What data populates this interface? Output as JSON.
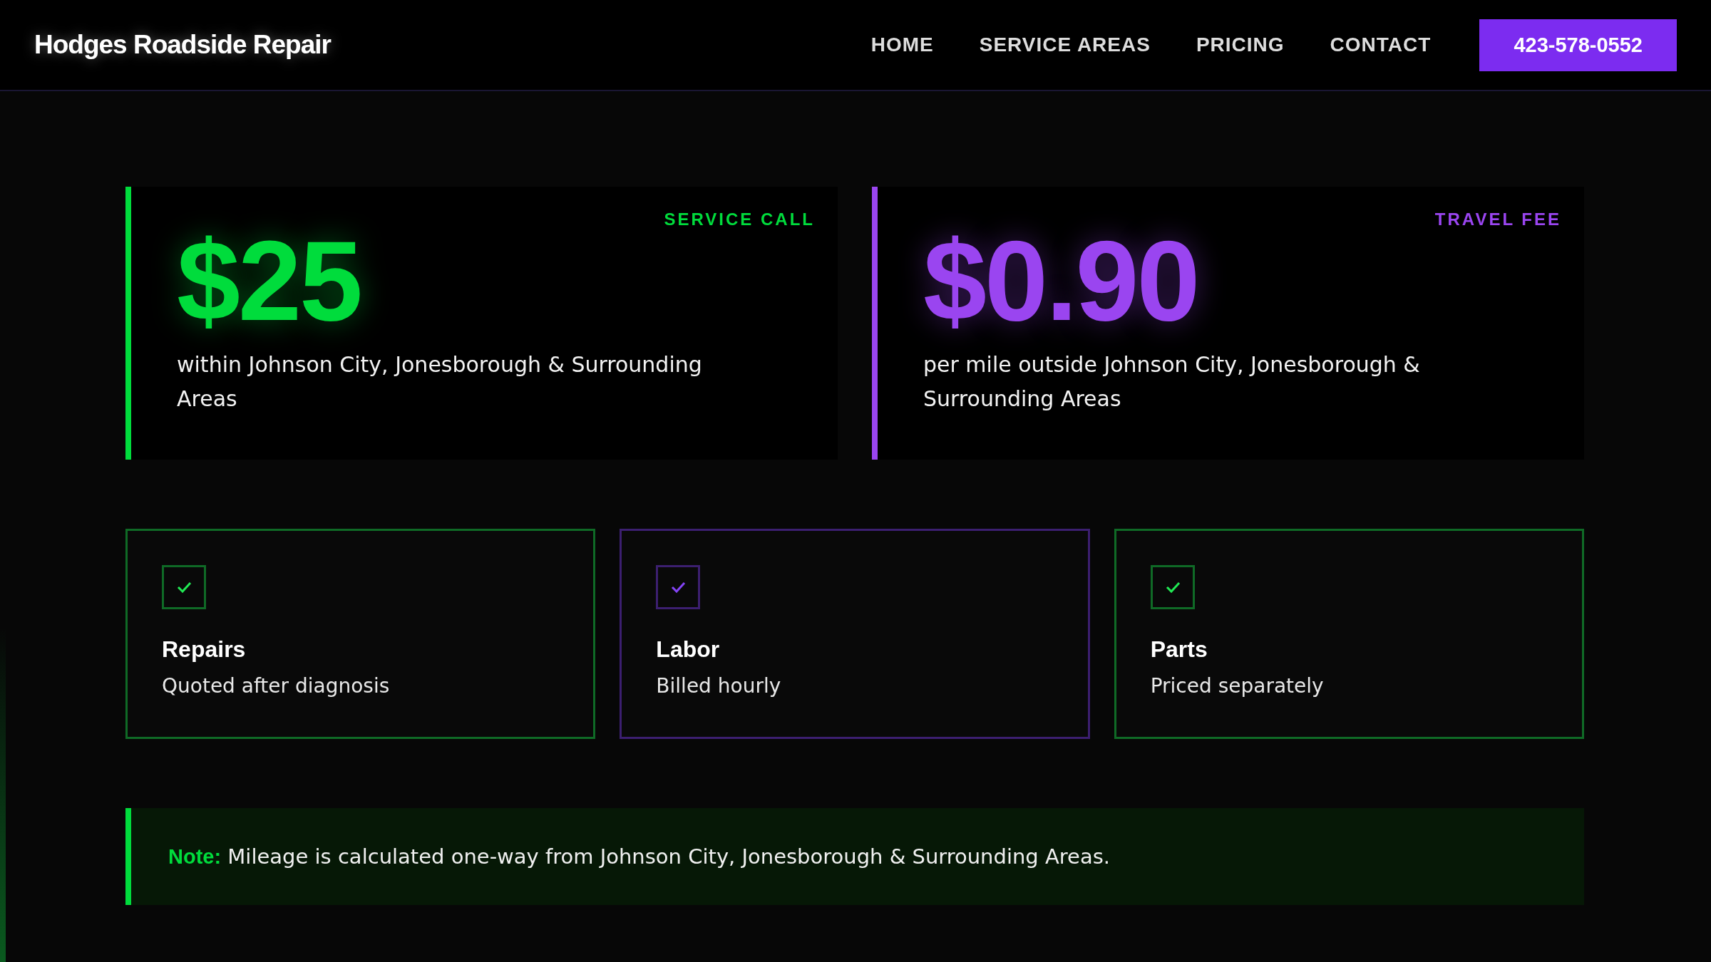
{
  "header": {
    "logo": "Hodges Roadside Repair",
    "nav": [
      {
        "label": "HOME"
      },
      {
        "label": "SERVICE AREAS"
      },
      {
        "label": "PRICING"
      },
      {
        "label": "CONTACT"
      }
    ],
    "phone_button": "423-578-0552"
  },
  "price_cards": [
    {
      "label": "SERVICE CALL",
      "price": "$25",
      "description": "within Johnson City, Jonesborough & Surrounding Areas",
      "color": "#00dc3c"
    },
    {
      "label": "TRAVEL FEE",
      "price": "$0.90",
      "description": "per mile outside Johnson City, Jonesborough & Surrounding Areas",
      "color": "#9a45f0"
    }
  ],
  "features": [
    {
      "title": "Repairs",
      "subtitle": "Quoted after diagnosis",
      "color": "#0f6a26"
    },
    {
      "title": "Labor",
      "subtitle": "Billed hourly",
      "color": "#3c1f70"
    },
    {
      "title": "Parts",
      "subtitle": "Priced separately",
      "color": "#0f6a26"
    }
  ],
  "note": "**Note:** Mileage is calculated one-way from Johnson City, Jonesborough & Surrounding Areas."
}
